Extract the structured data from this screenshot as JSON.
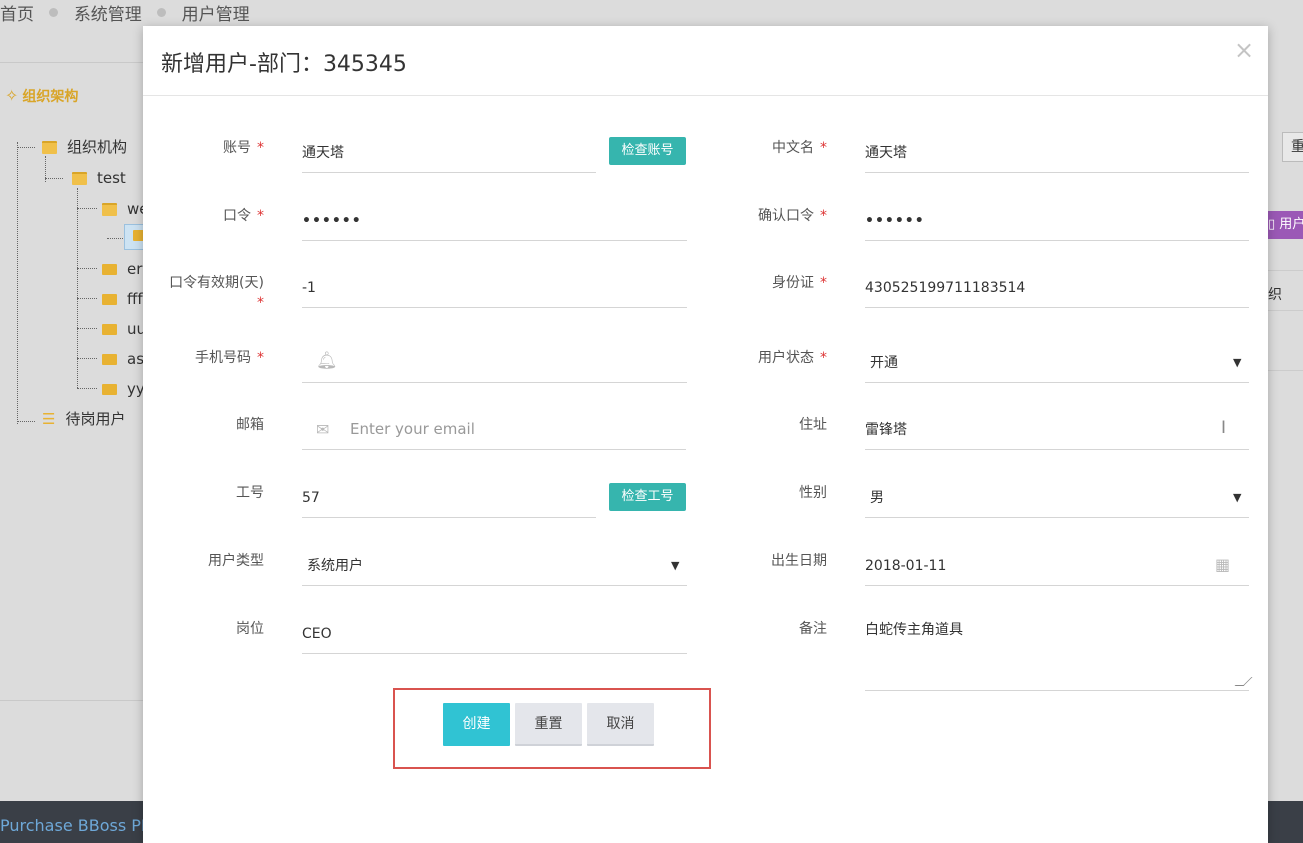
{
  "breadcrumb": [
    "首页",
    "系统管理",
    "用户管理"
  ],
  "sidebar": {
    "title": "组织架构",
    "tree": {
      "root": "组织机构",
      "child": "test",
      "items": [
        "we",
        "",
        "er",
        "fff",
        "uu",
        "as",
        "yy"
      ],
      "standby": "待岗用户"
    }
  },
  "background_right": {
    "button": "重",
    "purple_button": "用户",
    "text": "织"
  },
  "footer": {
    "text": "Purchase BBoss PD"
  },
  "modal": {
    "title": "新增用户-部门：345345",
    "close": "×",
    "required_mark": "*",
    "left": {
      "account": {
        "label": "账号",
        "value": "通天塔",
        "check_button": "检查账号"
      },
      "password": {
        "label": "口令",
        "value": "••••••"
      },
      "password_validity": {
        "label": "口令有效期(天)",
        "value": "-1"
      },
      "phone": {
        "label": "手机号码",
        "value": ""
      },
      "email": {
        "label": "邮箱",
        "placeholder": "Enter your email"
      },
      "work_no": {
        "label": "工号",
        "value": "57",
        "check_button": "检查工号"
      },
      "user_type": {
        "label": "用户类型",
        "value": "系统用户"
      },
      "position": {
        "label": "岗位",
        "value": "CEO"
      }
    },
    "right": {
      "chinese_name": {
        "label": "中文名",
        "value": "通天塔"
      },
      "confirm_password": {
        "label": "确认口令",
        "value": "••••••"
      },
      "id_card": {
        "label": "身份证",
        "value": "430525199711183514"
      },
      "user_status": {
        "label": "用户状态",
        "value": "开通"
      },
      "address": {
        "label": "住址",
        "value": "雷锋塔"
      },
      "gender": {
        "label": "性别",
        "value": "男"
      },
      "birth_date": {
        "label": "出生日期",
        "value": "2018-01-11"
      },
      "remark": {
        "label": "备注",
        "value": "白蛇传主角道具"
      }
    },
    "actions": {
      "create": "创建",
      "reset": "重置",
      "cancel": "取消"
    }
  }
}
